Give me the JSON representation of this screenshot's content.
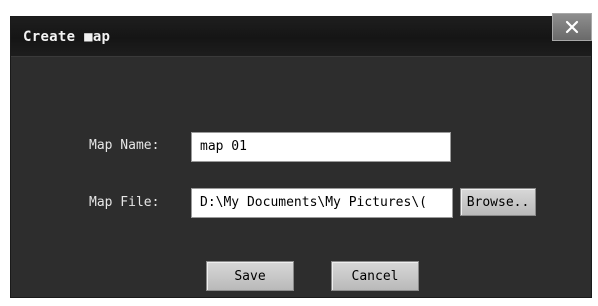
{
  "dialog": {
    "title": "Create ■ap",
    "close_icon": "close-icon"
  },
  "form": {
    "map_name_label": "Map Name:",
    "map_name_value": "map 01",
    "map_file_label": "Map File:",
    "map_file_value": "D:\\My Documents\\My Pictures\\(",
    "browse_label": "Browse.."
  },
  "actions": {
    "save_label": "Save",
    "cancel_label": "Cancel"
  },
  "colors": {
    "dialog_background": "#2d2d2d",
    "titlebar": "#1a1a1a",
    "button": "#c8c8c8"
  }
}
